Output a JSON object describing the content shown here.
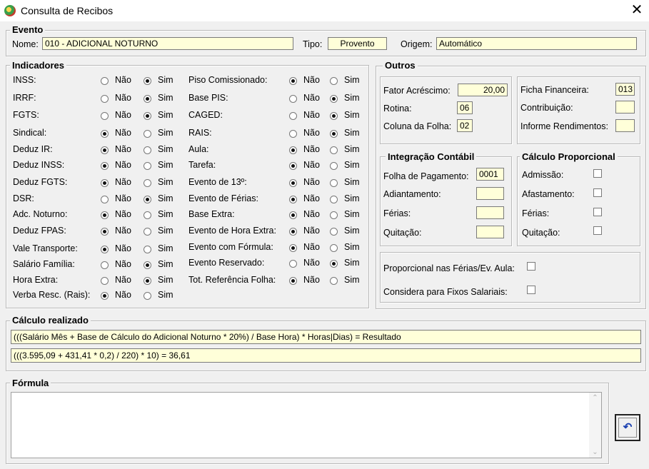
{
  "window": {
    "title": "Consulta de Recibos",
    "close_glyph": "✕"
  },
  "evento": {
    "legend": "Evento",
    "nome_label": "Nome:",
    "nome_value": "010 - ADICIONAL NOTURNO",
    "tipo_label": "Tipo:",
    "tipo_value": "Provento",
    "origem_label": "Origem:",
    "origem_value": "Automático"
  },
  "indicadores": {
    "legend": "Indicadores",
    "no": "Não",
    "yes": "Sim",
    "left": [
      {
        "label": "INSS:",
        "sel": "sim"
      },
      {
        "label": "IRRF:",
        "sel": "sim"
      },
      {
        "label": "FGTS:",
        "sel": "sim"
      },
      {
        "label": "Sindical:",
        "sel": "nao"
      },
      {
        "label": "Deduz IR:",
        "sel": "nao"
      },
      {
        "label": "Deduz INSS:",
        "sel": "nao"
      },
      {
        "label": "Deduz FGTS:",
        "sel": "nao"
      },
      {
        "label": "DSR:",
        "sel": "sim"
      },
      {
        "label": "Adc. Noturno:",
        "sel": "nao"
      },
      {
        "label": "Deduz FPAS:",
        "sel": "nao"
      },
      {
        "label": "Vale Transporte:",
        "sel": "nao"
      },
      {
        "label": "Salário Família:",
        "sel": "sim"
      },
      {
        "label": "Hora Extra:",
        "sel": "sim"
      },
      {
        "label": "Verba Resc. (Rais):",
        "sel": "nao"
      }
    ],
    "right": [
      {
        "label": "Piso Comissionado:",
        "sel": "nao"
      },
      {
        "label": "Base PIS:",
        "sel": "sim"
      },
      {
        "label": "CAGED:",
        "sel": "sim"
      },
      {
        "label": "RAIS:",
        "sel": "sim"
      },
      {
        "label": "Aula:",
        "sel": "nao"
      },
      {
        "label": "Tarefa:",
        "sel": "nao"
      },
      {
        "label": "Evento de 13º:",
        "sel": "nao"
      },
      {
        "label": "Evento de Férias:",
        "sel": "nao"
      },
      {
        "label": "Base Extra:",
        "sel": "nao"
      },
      {
        "label": "Evento de Hora Extra:",
        "sel": "nao"
      },
      {
        "label": "Evento com Fórmula:",
        "sel": "nao"
      },
      {
        "label": "Evento Reservado:",
        "sel": "sim"
      },
      {
        "label": "Tot. Referência Folha:",
        "sel": "nao"
      }
    ]
  },
  "outros": {
    "legend": "Outros",
    "fator_label": "Fator Acréscimo:",
    "fator_value": "20,00",
    "rotina_label": "Rotina:",
    "rotina_value": "06",
    "coluna_label": "Coluna da Folha:",
    "coluna_value": "02",
    "ficha_label": "Ficha Financeira:",
    "ficha_value": "013",
    "contribuicao_label": "Contribuição:",
    "contribuicao_value": "",
    "informe_label": "Informe Rendimentos:",
    "informe_value": ""
  },
  "integracao": {
    "legend": "Integração Contábil",
    "folha_label": "Folha de Pagamento:",
    "folha_value": "0001",
    "adiantamento_label": "Adiantamento:",
    "adiantamento_value": "",
    "ferias_label": "Férias:",
    "ferias_value": "",
    "quitacao_label": "Quitação:",
    "quitacao_value": ""
  },
  "proporcional": {
    "legend": "Cálculo Proporcional",
    "admissao_label": "Admissão:",
    "afastamento_label": "Afastamento:",
    "ferias_label": "Férias:",
    "quitacao_label": "Quitação:"
  },
  "extras": {
    "prop_ferias_label": "Proporcional nas Férias/Ev. Aula:",
    "fixos_label": "Considera para Fixos Salariais:"
  },
  "calculo": {
    "legend": "Cálculo realizado",
    "line1": "(((Salário Mês + Base de Cálculo do Adicional Noturno * 20%) / Base Hora) * Horas|Dias) = Resultado",
    "line2": "(((3.595,09 + 431,41 * 0,2) / 220) * 10) = 36,61"
  },
  "formula": {
    "legend": "Fórmula",
    "scroll_up": "⌃",
    "scroll_down": "⌄"
  },
  "undo_button": {
    "glyph": "↶"
  }
}
